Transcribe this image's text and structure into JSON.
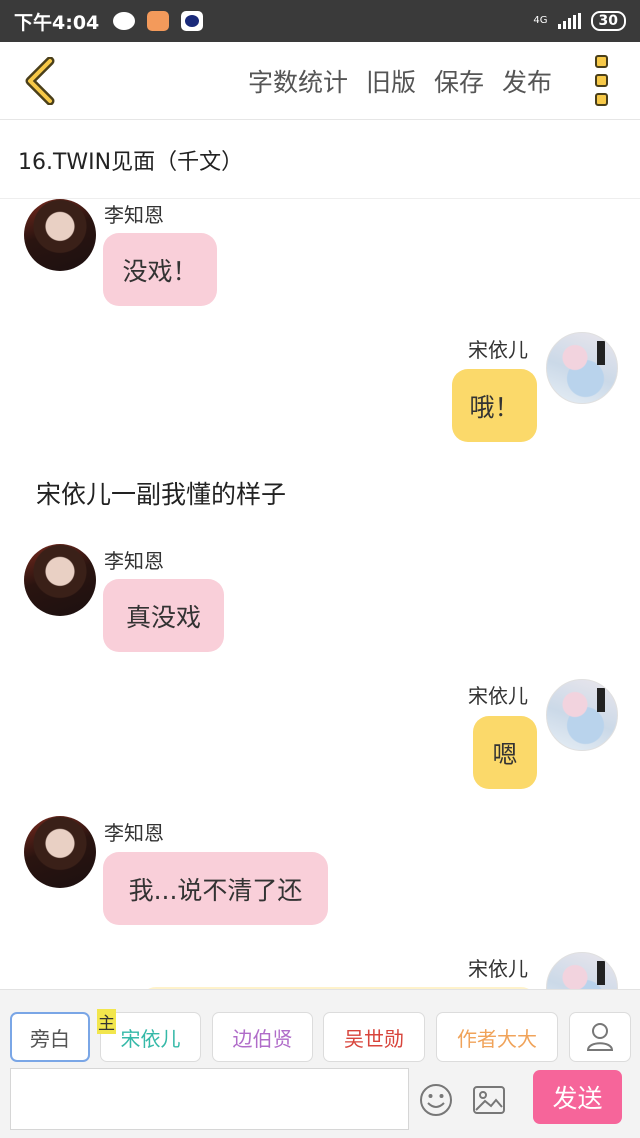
{
  "status_bar": {
    "time": "下午4:04",
    "network": "4G",
    "battery": "30"
  },
  "toolbar": {
    "actions": [
      "字数统计",
      "旧版",
      "保存",
      "发布"
    ]
  },
  "chapter": {
    "title": "16.TWIN见面（千文）"
  },
  "messages": [
    {
      "side": "left",
      "name": "李知恩",
      "text": "没戏！"
    },
    {
      "side": "right",
      "name": "宋依儿",
      "text": "哦！"
    },
    {
      "side": "narration",
      "text": "宋依儿一副我懂的样子"
    },
    {
      "side": "left",
      "name": "李知恩",
      "text": "真没戏"
    },
    {
      "side": "right",
      "name": "宋依儿",
      "text": "嗯"
    },
    {
      "side": "left",
      "name": "李知恩",
      "text": "我...说不清了还"
    },
    {
      "side": "right",
      "name": "宋依儿",
      "text": ""
    }
  ],
  "roles": [
    {
      "label": "旁白",
      "color": "#555555"
    },
    {
      "label": "宋依儿",
      "color": "#35b9a8",
      "tag": "主"
    },
    {
      "label": "边伯贤",
      "color": "#b06cc9"
    },
    {
      "label": "吴世勋",
      "color": "#d8453c"
    },
    {
      "label": "作者大大",
      "color": "#f0a35a"
    }
  ],
  "composer": {
    "send_label": "发送",
    "input_value": ""
  },
  "colors": {
    "left_bubble": "#f9cfd9",
    "right_bubble": "#fbd96a",
    "send": "#f6659a",
    "accent": "#f7c948"
  }
}
